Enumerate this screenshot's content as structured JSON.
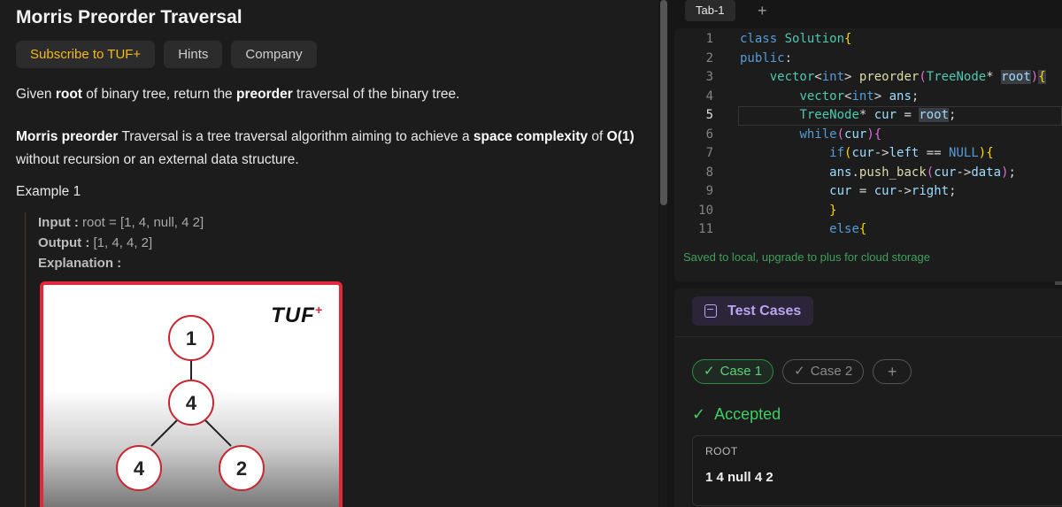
{
  "problem": {
    "title": "Morris Preorder Traversal",
    "buttons": {
      "subscribe": "Subscribe to TUF+",
      "hints": "Hints",
      "company": "Company"
    },
    "p1": {
      "a": "Given ",
      "b": "root",
      "c": " of binary tree, return the ",
      "d": "preorder",
      "e": " traversal of the binary tree."
    },
    "p2": {
      "a": "Morris preorder",
      "b": " Traversal is a tree traversal algorithm aiming to achieve a ",
      "c": "space complexity",
      "d": " of ",
      "e": "O(1)",
      "f": " without recursion or an external data structure."
    },
    "example_title": "Example 1",
    "input_label": "Input :",
    "input_value": " root = [1, 4, null, 4 2]",
    "output_label": "Output :",
    "output_value": " [1, 4, 4, 2]",
    "explanation_label": "Explanation :",
    "image_logo": "TUF",
    "image_logo_mark": "+",
    "tree_nodes": [
      "1",
      "4",
      "4",
      "2"
    ]
  },
  "editor": {
    "tab": "Tab-1",
    "add_tab": "+",
    "line_numbers": [
      "1",
      "2",
      "3",
      "4",
      "5",
      "6",
      "7",
      "8",
      "9",
      "10",
      "11"
    ],
    "saved_message": "Saved to local, upgrade to plus for cloud storage"
  },
  "tests": {
    "title": "Test Cases",
    "cases": [
      {
        "label": "Case 1",
        "selected": true
      },
      {
        "label": "Case 2",
        "selected": false
      }
    ],
    "add_case": "+",
    "status": "Accepted",
    "check": "✓",
    "root_label": "ROOT",
    "root_value": "1 4 null 4 2"
  },
  "colors": {
    "accent_purple": "#b9a6f0",
    "success_green": "#3fcf63",
    "subscribe_gold": "#f5b91e",
    "card_red": "#e2293a"
  }
}
